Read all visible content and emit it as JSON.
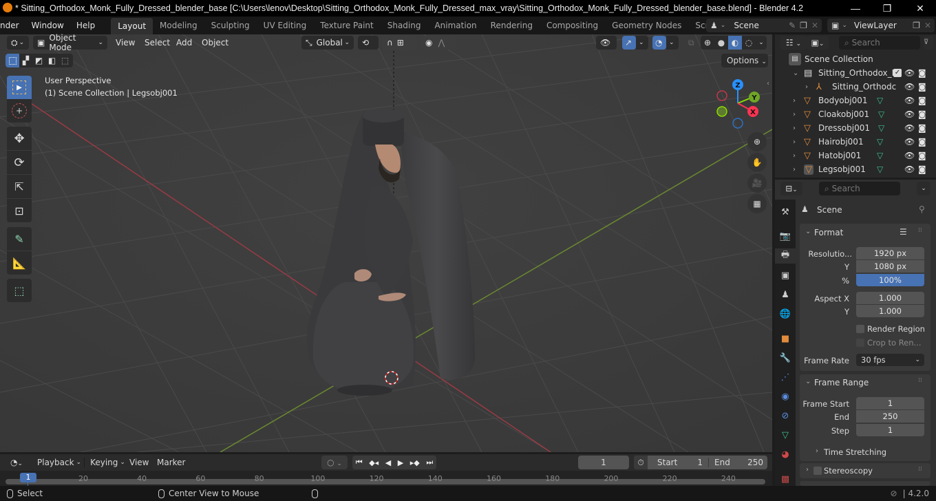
{
  "window": {
    "title": "* Sitting_Orthodox_Monk_Fully_Dressed_blender_base [C:\\Users\\lenov\\Desktop\\Sitting_Orthodox_Monk_Fully_Dressed_max_vray\\Sitting_Orthodox_Monk_Fully_Dressed_blender_base.blend] - Blender 4.2",
    "controls": {
      "minimize": "—",
      "maximize": "❐",
      "close": "✕"
    }
  },
  "menubar": {
    "items": [
      "nder",
      "Window",
      "Help"
    ],
    "workspaces": [
      "Layout",
      "Modeling",
      "Sculpting",
      "UV Editing",
      "Texture Paint",
      "Shading",
      "Animation",
      "Rendering",
      "Compositing",
      "Geometry Nodes",
      "Scripting"
    ],
    "active_workspace": "Layout",
    "add_workspace": "+",
    "scene": "Scene",
    "view_layer": "ViewLayer"
  },
  "viewport": {
    "mode": "Object Mode",
    "menus": [
      "View",
      "Select",
      "Add",
      "Object"
    ],
    "orientation": "Global",
    "options_label": "Options",
    "overlay_line1": "User Perspective",
    "overlay_line2": "(1) Scene Collection | Legsobj001",
    "gizmo": {
      "z": "Z",
      "y": "Y",
      "x": "X"
    },
    "axis_colors": {
      "x": "#ff3352",
      "y": "#8bdc00",
      "z": "#2890ff"
    },
    "tools": [
      "select-box",
      "cursor",
      "move",
      "rotate",
      "scale",
      "transform",
      "annotate",
      "measure",
      "add-cube"
    ],
    "nav_buttons": [
      "zoom",
      "pan",
      "camera",
      "ortho-grid"
    ]
  },
  "outliner": {
    "search_placeholder": "Search",
    "root": "Scene Collection",
    "items": [
      {
        "name": "Sitting_Orthodox_M",
        "type": "collection",
        "level": 1,
        "expanded": true,
        "checked": true
      },
      {
        "name": "Sitting_Orthodc",
        "type": "empty",
        "level": 2,
        "expanded": false
      },
      {
        "name": "Bodyobj001",
        "type": "mesh",
        "level": 1
      },
      {
        "name": "Cloakobj001",
        "type": "mesh",
        "level": 1
      },
      {
        "name": "Dressobj001",
        "type": "mesh",
        "level": 1
      },
      {
        "name": "Hairobj001",
        "type": "mesh",
        "level": 1
      },
      {
        "name": "Hatobj001",
        "type": "mesh",
        "level": 1
      },
      {
        "name": "Legsobj001",
        "type": "mesh",
        "level": 1,
        "active": true
      }
    ]
  },
  "properties": {
    "search_placeholder": "Search",
    "context": "Scene",
    "format": {
      "title": "Format",
      "resolution_x_label": "Resolutio...",
      "resolution_x": "1920 px",
      "resolution_y_label": "Y",
      "resolution_y": "1080 px",
      "percent_label": "%",
      "percent": "100%",
      "aspect_x_label": "Aspect X",
      "aspect_x": "1.000",
      "aspect_y_label": "Y",
      "aspect_y": "1.000",
      "render_region": "Render Region",
      "crop": "Crop to Ren...",
      "frame_rate_label": "Frame Rate",
      "frame_rate": "30 fps"
    },
    "frame_range": {
      "title": "Frame Range",
      "start_label": "Frame Start",
      "start": "1",
      "end_label": "End",
      "end": "250",
      "step_label": "Step",
      "step": "1",
      "time_stretching": "Time Stretching"
    },
    "stereoscopy": "Stereoscopy"
  },
  "timeline": {
    "menus": [
      "Playback",
      "Keying",
      "View",
      "Marker"
    ],
    "current_frame": "1",
    "start_label": "Start",
    "start": "1",
    "end_label": "End",
    "end": "250",
    "ticks": [
      "20",
      "40",
      "60",
      "80",
      "100",
      "120",
      "140",
      "160",
      "180",
      "200",
      "220",
      "240"
    ],
    "playhead": "1"
  },
  "statusbar": {
    "left": "Select",
    "middle": "Center View to Mouse",
    "version": "4.2.0"
  }
}
